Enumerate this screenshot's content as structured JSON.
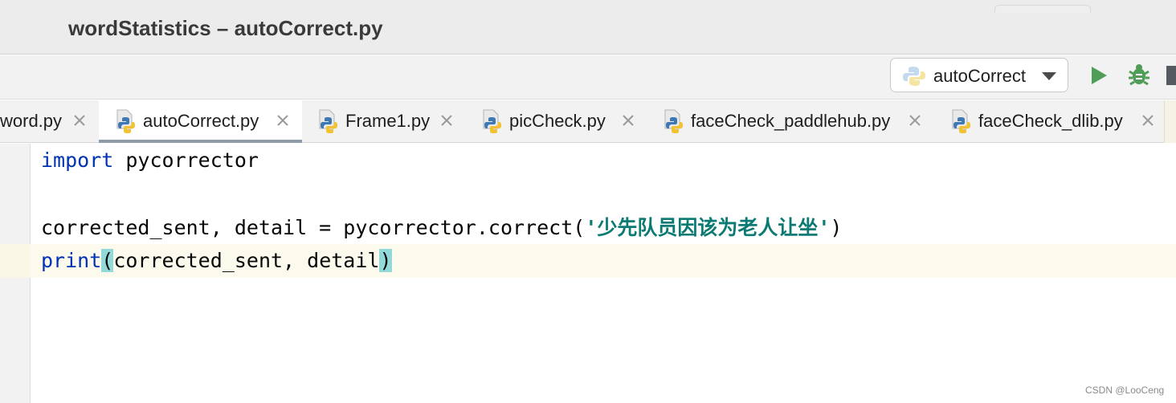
{
  "window": {
    "title": "wordStatistics – autoCorrect.py"
  },
  "toolbar": {
    "run_config_label": "autoCorrect",
    "run_icon": "run-icon",
    "debug_icon": "debug-icon",
    "coverage_icon": "shield-icon"
  },
  "tabs": [
    {
      "label": "word.py",
      "active": false
    },
    {
      "label": "autoCorrect.py",
      "active": true
    },
    {
      "label": "Frame1.py",
      "active": false
    },
    {
      "label": "picCheck.py",
      "active": false
    },
    {
      "label": "faceCheck_paddlehub.py",
      "active": false
    },
    {
      "label": "faceCheck_dlib.py",
      "active": false
    }
  ],
  "editor": {
    "lines": [
      {
        "kw": "import",
        "rest": " pycorrector"
      },
      {
        "text": ""
      },
      {
        "pre": "corrected_sent, detail = pycorrector.correct(",
        "str": "'少先队员因该为老人让坐'",
        "post": ")"
      },
      {
        "kw": "print",
        "open": "(",
        "mid": "corrected_sent, detail",
        "close": ")"
      }
    ]
  },
  "watermark": "CSDN @LooCeng",
  "colors": {
    "keyword": "#0033b3",
    "string": "#0a7a73",
    "brace_highlight": "#93d9d9",
    "active_tab_underline": "#8f9ca8"
  }
}
